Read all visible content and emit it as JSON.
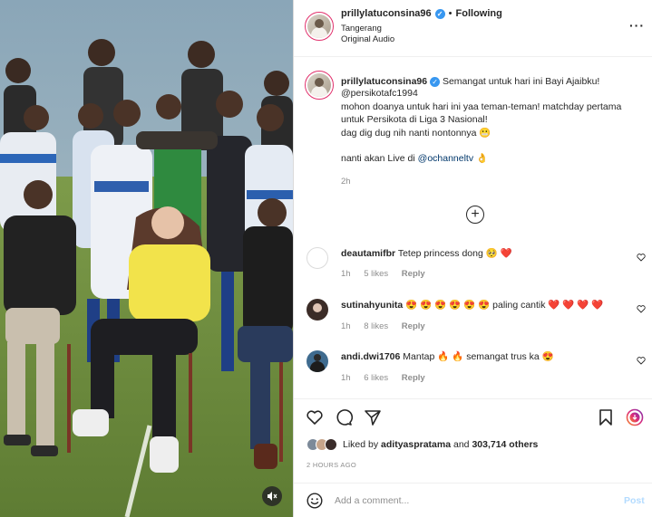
{
  "post": {
    "username": "prillylatuconsina96",
    "follow_separator": "•",
    "follow_label": "Following",
    "location": "Tangerang",
    "audio": "Original Audio",
    "more_label": "···"
  },
  "caption": {
    "username": "prillylatuconsina96",
    "text_line1": "Semangat untuk hari ini Bayi Ajaibku!",
    "mention1": "@persikotafc1994",
    "line2": "mohon doanya untuk hari ini yaa teman-teman! matchday pertama",
    "line3": "untuk Persikota di Liga 3 Nasional!",
    "line4": "dag dig dug nih nanti nontonnya 😬",
    "line5_prefix": "nanti akan Live di ",
    "mention2": "@ochanneltv",
    "line5_suffix": " 👌",
    "time": "2h"
  },
  "comments": [
    {
      "username": "deautamifbr",
      "text": "Tetep princess dong 🥺 ❤️",
      "time": "1h",
      "likes": "5 likes",
      "reply": "Reply"
    },
    {
      "username": "sutinahyunita",
      "text": "😍 😍 😍 😍 😍 😍  paling cantik ❤️ ❤️ ❤️ ❤️",
      "time": "1h",
      "likes": "8 likes",
      "reply": "Reply"
    },
    {
      "username": "andi.dwi1706",
      "text": "Mantap 🔥 🔥  semangat trus ka 😍",
      "time": "1h",
      "likes": "6 likes",
      "reply": "Reply"
    }
  ],
  "likes": {
    "prefix": "Liked by ",
    "user": "adityaspratama",
    "middle": " and ",
    "count": "303,714 others"
  },
  "timestamp": "2 HOURS AGO",
  "add_comment": {
    "placeholder": "Add a comment...",
    "post_label": "Post"
  },
  "icons": {
    "verified": "verified-badge-icon",
    "more": "more-options-icon",
    "load_more": "plus-circle-icon",
    "like": "heart-icon",
    "comment": "comment-bubble-icon",
    "share": "paper-plane-icon",
    "save": "bookmark-icon",
    "mute": "muted-speaker-icon",
    "emoji": "emoji-smiley-icon"
  },
  "colors": {
    "mention": "#00376b",
    "verified": "#3897f0",
    "secondary_text": "#8e8e8e",
    "post_button_disabled": "#b3dbff",
    "heart_red": "#ed4956"
  }
}
